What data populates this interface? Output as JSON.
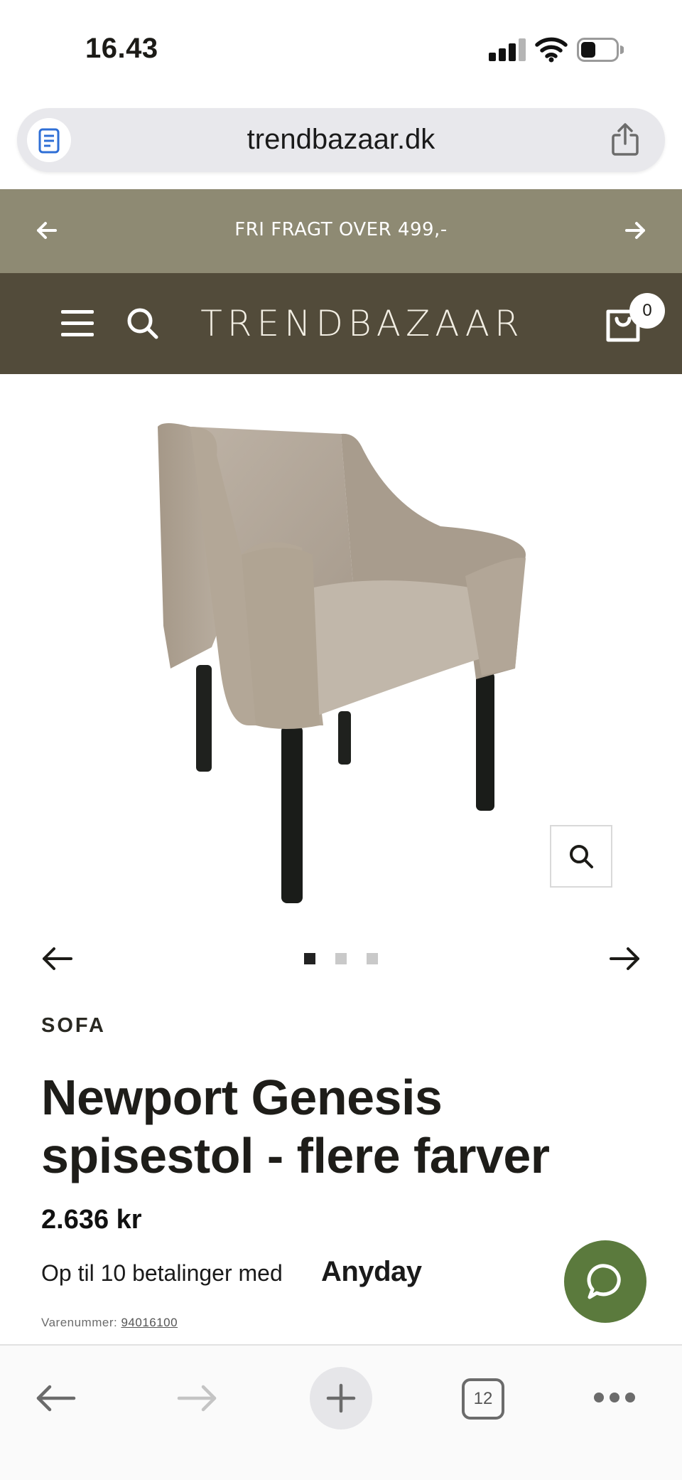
{
  "status_bar": {
    "time": "16.43"
  },
  "browser": {
    "url": "trendbazaar.dk",
    "tab_count": "12"
  },
  "announcement": {
    "text": "FRI FRAGT OVER 499,-"
  },
  "header": {
    "logo": "TRENDBAZAAR",
    "cart_count": "0",
    "brand_color": "#524b3a",
    "announce_color": "#8e8a73"
  },
  "carousel": {
    "slide_count": 3,
    "active_index": 0
  },
  "product": {
    "vendor": "SOFA",
    "title": "Newport Genesis spisestol - flere farver",
    "price": "2.636 kr",
    "installments_text": "Op til 10 betalinger med",
    "installments_provider": "Anyday",
    "sku_label": "Varenummer:",
    "sku_value": "94016100"
  },
  "chat": {
    "color": "#5b7a3d",
    "icon": "chat-bubble-icon"
  }
}
